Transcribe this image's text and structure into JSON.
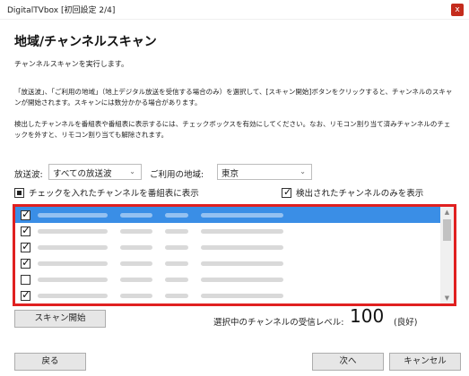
{
  "window": {
    "title": "DigitalTVbox [初回設定 2/4]",
    "close_glyph": "x"
  },
  "page": {
    "heading": "地域/チャンネルスキャン",
    "subtitle": "チャンネルスキャンを実行します。",
    "description_1": "「放送波」、「ご利用の地域」（地上デジタル放送を受信する場合のみ）を選択して、[スキャン開始]ボタンをクリックすると、チャンネルのスキャンが開始されます。スキャンには数分かかる場合があります。",
    "description_2": "検出したチャンネルを番組表や番組表に表示するには、チェックボックスを有効にしてください。なお、リモコン割り当て済みチャンネルのチェックを外すと、リモコン割り当ても解除されます。"
  },
  "filters": {
    "broadcast_label": "放送波:",
    "broadcast_value": "すべての放送波",
    "region_label": "ご利用の地域:",
    "region_value": "東京"
  },
  "options": {
    "show_in_guide_label": "チェックを入れたチャンネルを番組表に表示",
    "show_in_guide_state": "partial",
    "detected_only_label": "検出されたチャンネルのみを表示",
    "detected_only_checked": true
  },
  "channel_list": {
    "rows": [
      {
        "checked": true,
        "selected": true
      },
      {
        "checked": true,
        "selected": false
      },
      {
        "checked": true,
        "selected": false
      },
      {
        "checked": true,
        "selected": false
      },
      {
        "checked": false,
        "selected": false
      },
      {
        "checked": true,
        "selected": false
      }
    ],
    "note": ""
  },
  "actions": {
    "scan_start": "スキャン開始",
    "back": "戻る",
    "next": "次へ",
    "cancel": "キャンセル"
  },
  "signal": {
    "label": "選択中のチャンネルの受信レベル:",
    "value": "100",
    "status": "(良好)"
  },
  "colors": {
    "highlight_border": "#e02020",
    "selected_row": "#3a8ee6",
    "close_button": "#c42b1c"
  }
}
